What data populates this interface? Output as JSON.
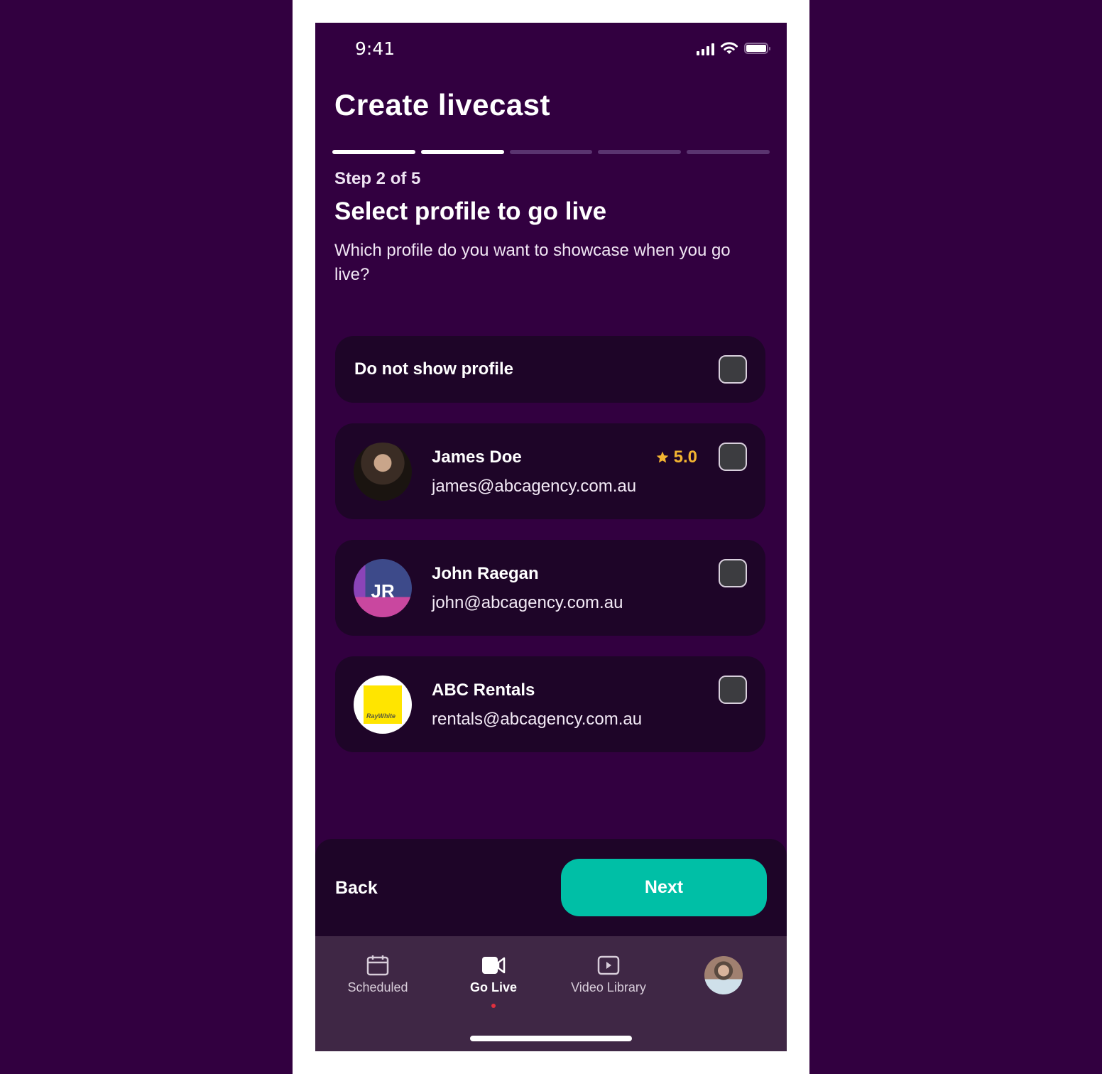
{
  "status_bar": {
    "time": "9:41",
    "icons": [
      "signal-icon",
      "wifi-icon",
      "battery-icon"
    ]
  },
  "header": {
    "title": "Create livecast"
  },
  "progress": {
    "current_step": 2,
    "total_steps": 5
  },
  "step": {
    "label": "Step 2 of 5",
    "title": "Select profile to go live",
    "description": "Which profile do you want to showcase when you go live?"
  },
  "options": {
    "none": {
      "label": "Do not show profile",
      "checked": false
    },
    "profiles": [
      {
        "name": "James Doe",
        "email": "james@abcagency.com.au",
        "rating": "5.0",
        "avatar": "photo",
        "checked": false
      },
      {
        "name": "John Raegan",
        "email": "john@abcagency.com.au",
        "initials": "JR",
        "avatar": "initials",
        "checked": false
      },
      {
        "name": "ABC Rentals",
        "email": "rentals@abcagency.com.au",
        "logo_text": "RayWhite",
        "avatar": "logo",
        "checked": false
      }
    ]
  },
  "actions": {
    "back_label": "Back",
    "next_label": "Next"
  },
  "tab_bar": {
    "tabs": [
      {
        "label": "Scheduled",
        "icon": "calendar-icon",
        "active": false
      },
      {
        "label": "Go Live",
        "icon": "video-camera-icon",
        "active": true
      },
      {
        "label": "Video Library",
        "icon": "play-icon",
        "active": false
      }
    ],
    "profile_icon": "user-avatar"
  },
  "colors": {
    "background": "#320040",
    "card": "#1e0528",
    "accent": "#00bfa6",
    "rating": "#f3b431",
    "tab_bar": "#3f2745"
  }
}
